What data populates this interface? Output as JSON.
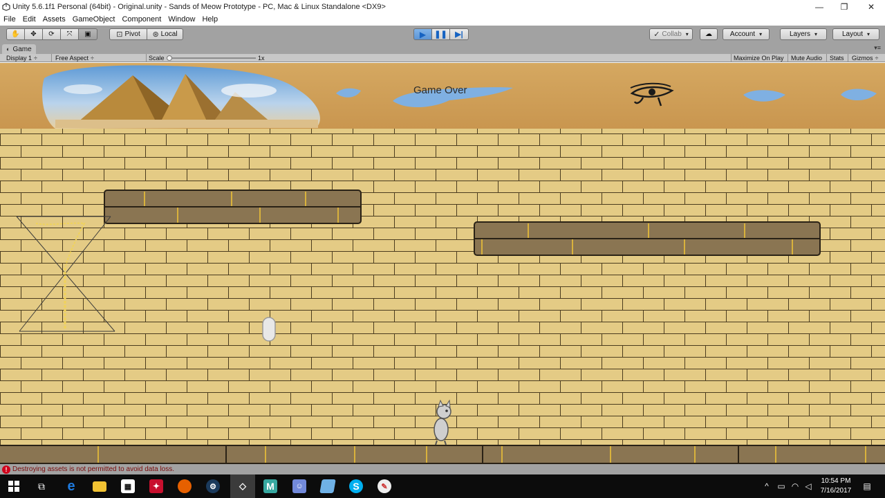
{
  "window": {
    "title": "Unity 5.6.1f1 Personal (64bit) - Original.unity - Sands of Meow Prototype - PC, Mac & Linux Standalone <DX9>",
    "minimize_glyph": "—",
    "maximize_glyph": "❐",
    "close_glyph": "✕"
  },
  "menu": [
    "File",
    "Edit",
    "Assets",
    "GameObject",
    "Component",
    "Window",
    "Help"
  ],
  "toolbar": {
    "transform_tools": [
      "hand-icon",
      "move-icon",
      "rotate-icon",
      "scale-icon",
      "rect-tool-icon"
    ],
    "pivot_label": "Pivot",
    "local_label": "Local",
    "collab_label": "Collab",
    "account_label": "Account",
    "layers_label": "Layers",
    "layout_label": "Layout",
    "play_state": "playing"
  },
  "game_tab": {
    "label": "Game",
    "display_label": "Display 1",
    "aspect_label": "Free Aspect",
    "scale_label": "Scale",
    "scale_value": "1x",
    "maximize_label": "Maximize On Play",
    "mute_label": "Mute Audio",
    "stats_label": "Stats",
    "gizmos_label": "Gizmos"
  },
  "game_view": {
    "overlay_text": "Game Over",
    "sky_color": "#d1a05a",
    "brick_color": "#e4cb85",
    "mortar_color": "#4a3b1e",
    "dark_block_color": "#8a7552",
    "gold_color": "#f0d35a"
  },
  "status": {
    "message": "Destroying assets is not permitted to avoid data loss."
  },
  "taskbar": {
    "apps": [
      "windows-start-icon",
      "task-view-icon",
      "edge-icon",
      "file-explorer-icon",
      "store-icon",
      "app-icon",
      "firefox-icon",
      "steam-icon",
      "unity-icon",
      "maya-icon",
      "discord-icon",
      "app-icon",
      "skype-icon",
      "paint-icon"
    ],
    "time": "10:54 PM",
    "date": "7/16/2017"
  }
}
